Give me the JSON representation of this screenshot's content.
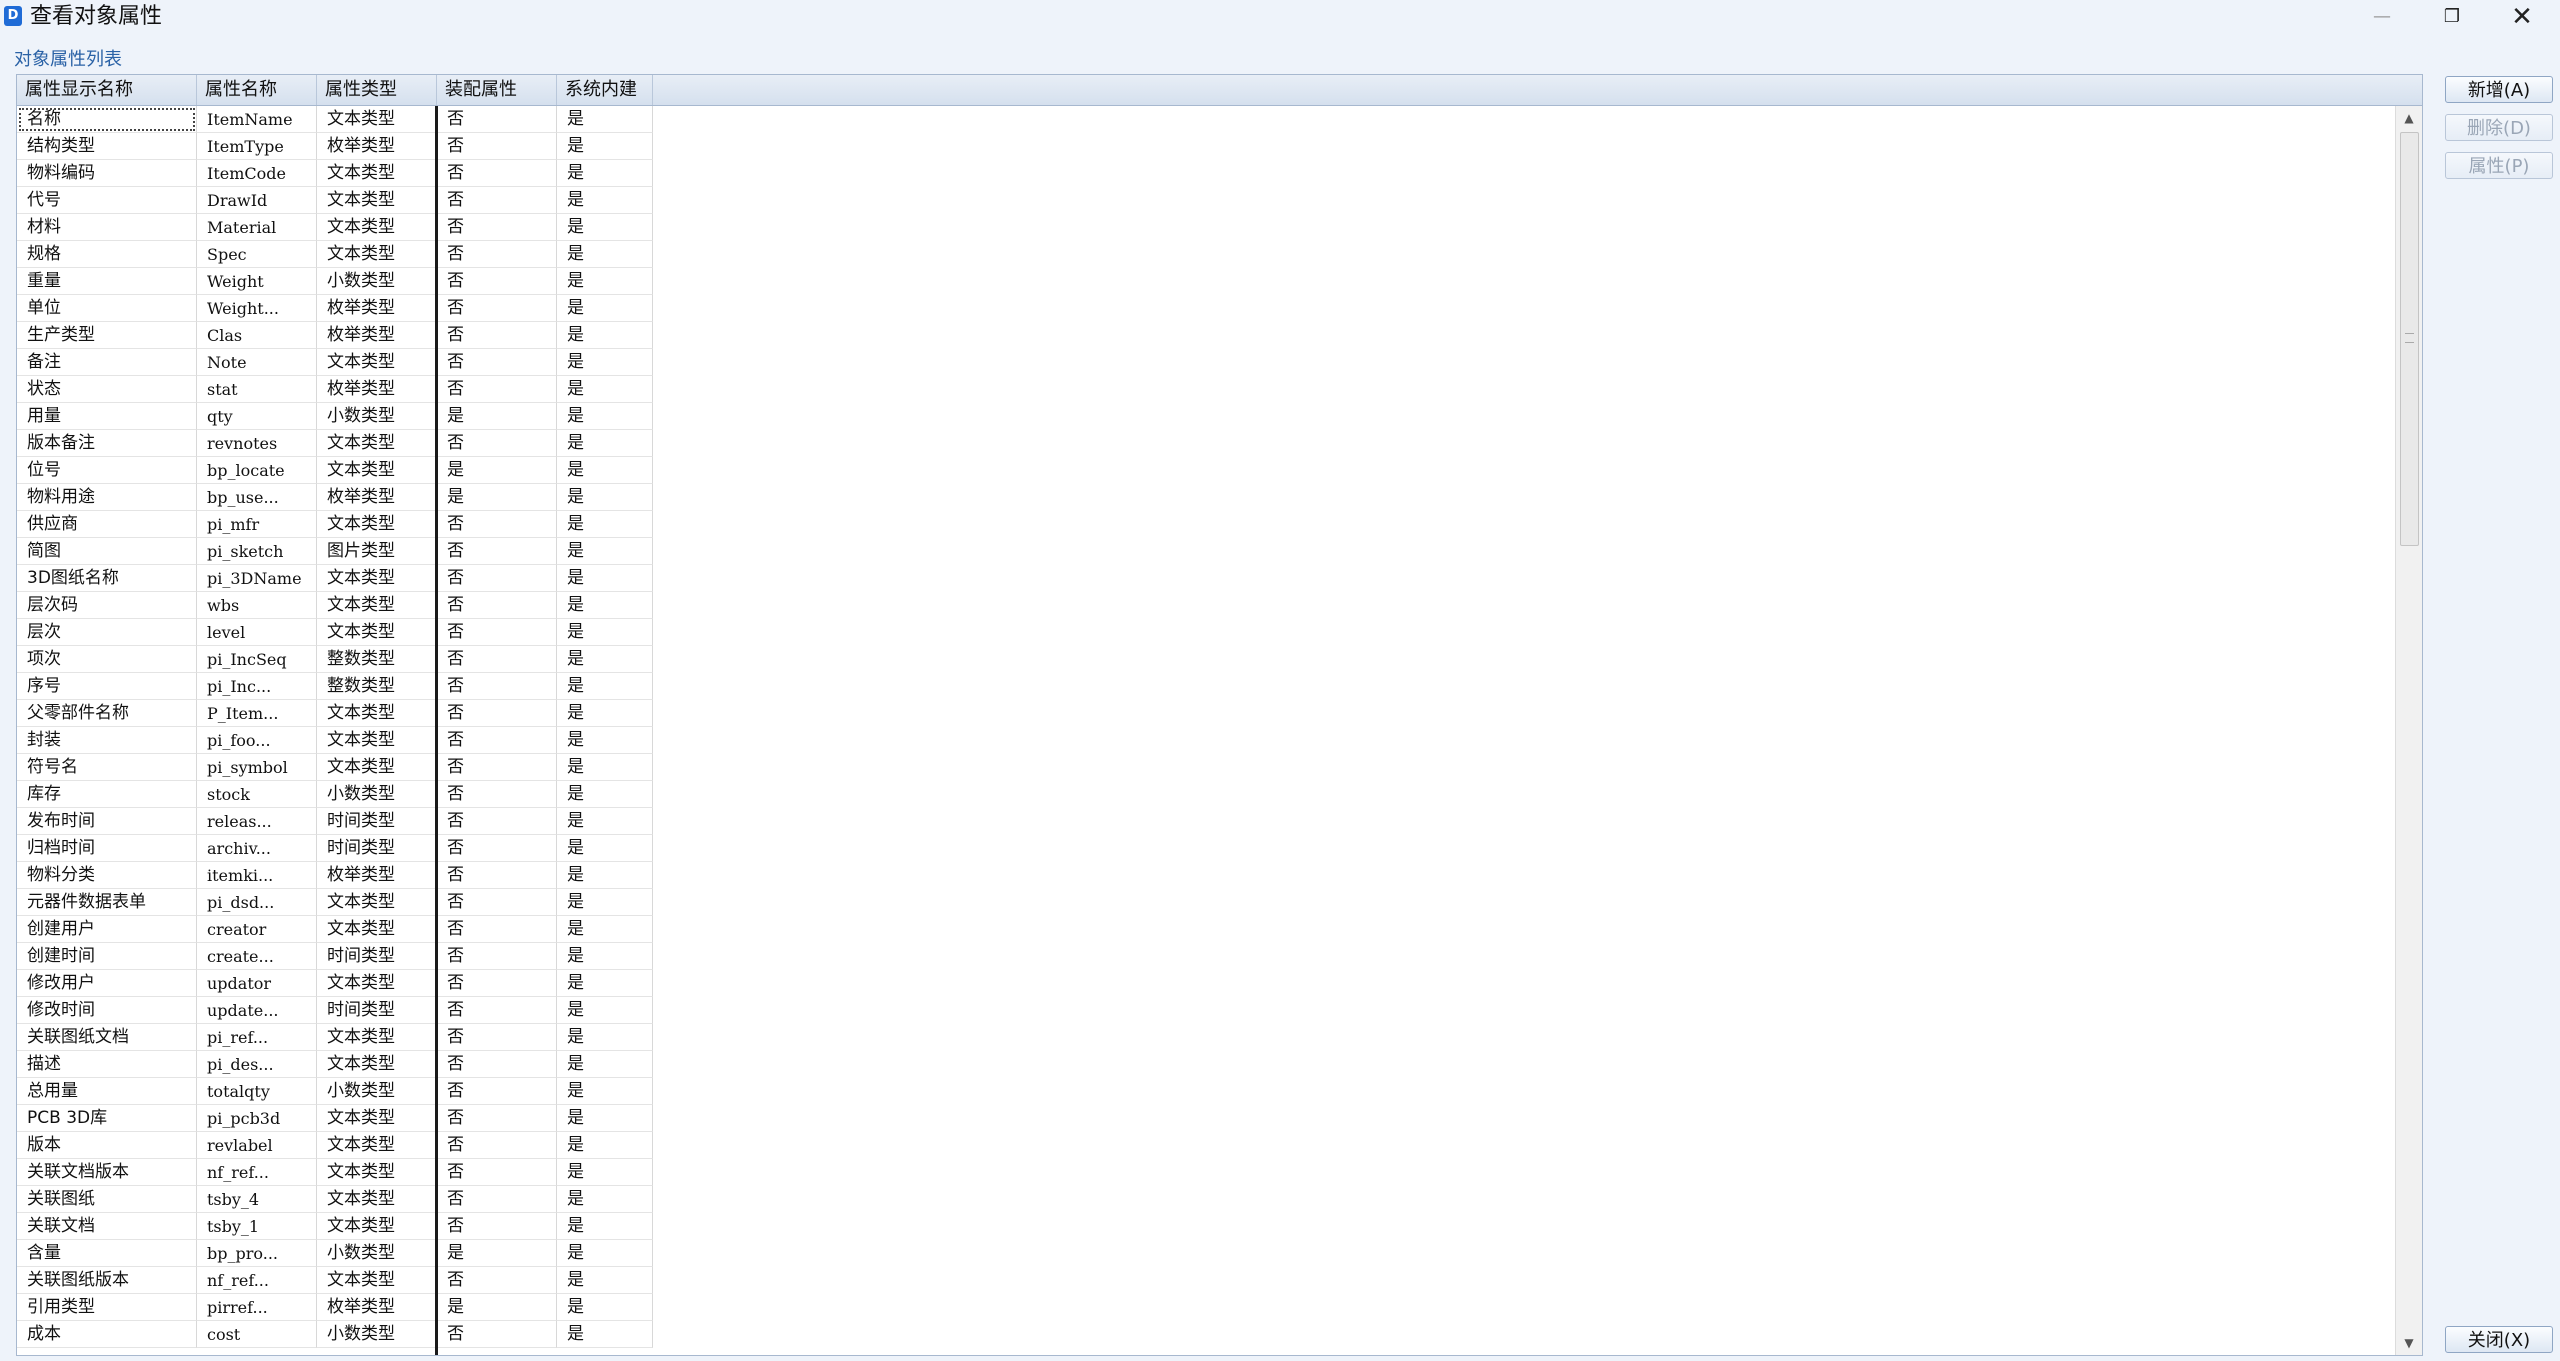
{
  "window": {
    "title": "查看对象属性",
    "app_icon_glyph": "D"
  },
  "list_caption": "对象属性列表",
  "columns": [
    "属性显示名称",
    "属性名称",
    "属性类型",
    "装配属性",
    "系统内建"
  ],
  "rows": [
    [
      "名称",
      "ItemName",
      "文本类型",
      "否",
      "是"
    ],
    [
      "结构类型",
      "ItemType",
      "枚举类型",
      "否",
      "是"
    ],
    [
      "物料编码",
      "ItemCode",
      "文本类型",
      "否",
      "是"
    ],
    [
      "代号",
      "DrawId",
      "文本类型",
      "否",
      "是"
    ],
    [
      "材料",
      "Material",
      "文本类型",
      "否",
      "是"
    ],
    [
      "规格",
      "Spec",
      "文本类型",
      "否",
      "是"
    ],
    [
      "重量",
      "Weight",
      "小数类型",
      "否",
      "是"
    ],
    [
      "单位",
      "Weight...",
      "枚举类型",
      "否",
      "是"
    ],
    [
      "生产类型",
      "Clas",
      "枚举类型",
      "否",
      "是"
    ],
    [
      "备注",
      "Note",
      "文本类型",
      "否",
      "是"
    ],
    [
      "状态",
      "stat",
      "枚举类型",
      "否",
      "是"
    ],
    [
      "用量",
      "qty",
      "小数类型",
      "是",
      "是"
    ],
    [
      "版本备注",
      "revnotes",
      "文本类型",
      "否",
      "是"
    ],
    [
      "位号",
      "bp_locate",
      "文本类型",
      "是",
      "是"
    ],
    [
      "物料用途",
      "bp_use...",
      "枚举类型",
      "是",
      "是"
    ],
    [
      "供应商",
      "pi_mfr",
      "文本类型",
      "否",
      "是"
    ],
    [
      "简图",
      "pi_sketch",
      "图片类型",
      "否",
      "是"
    ],
    [
      "3D图纸名称",
      "pi_3DName",
      "文本类型",
      "否",
      "是"
    ],
    [
      "层次码",
      "wbs",
      "文本类型",
      "否",
      "是"
    ],
    [
      "层次",
      "level",
      "文本类型",
      "否",
      "是"
    ],
    [
      "项次",
      "pi_IncSeq",
      "整数类型",
      "否",
      "是"
    ],
    [
      "序号",
      "pi_Inc...",
      "整数类型",
      "否",
      "是"
    ],
    [
      "父零部件名称",
      "P_Item...",
      "文本类型",
      "否",
      "是"
    ],
    [
      "封装",
      "pi_foo...",
      "文本类型",
      "否",
      "是"
    ],
    [
      "符号名",
      "pi_symbol",
      "文本类型",
      "否",
      "是"
    ],
    [
      "库存",
      "stock",
      "小数类型",
      "否",
      "是"
    ],
    [
      "发布时间",
      "releas...",
      "时间类型",
      "否",
      "是"
    ],
    [
      "归档时间",
      "archiv...",
      "时间类型",
      "否",
      "是"
    ],
    [
      "物料分类",
      "itemki...",
      "枚举类型",
      "否",
      "是"
    ],
    [
      "元器件数据表单",
      "pi_dsd...",
      "文本类型",
      "否",
      "是"
    ],
    [
      "创建用户",
      "creator",
      "文本类型",
      "否",
      "是"
    ],
    [
      "创建时间",
      "create...",
      "时间类型",
      "否",
      "是"
    ],
    [
      "修改用户",
      "updator",
      "文本类型",
      "否",
      "是"
    ],
    [
      "修改时间",
      "update...",
      "时间类型",
      "否",
      "是"
    ],
    [
      "关联图纸文档",
      "pi_ref...",
      "文本类型",
      "否",
      "是"
    ],
    [
      "描述",
      "pi_des...",
      "文本类型",
      "否",
      "是"
    ],
    [
      "总用量",
      "totalqty",
      "小数类型",
      "否",
      "是"
    ],
    [
      "PCB 3D库",
      "pi_pcb3d",
      "文本类型",
      "否",
      "是"
    ],
    [
      "版本",
      "revlabel",
      "文本类型",
      "否",
      "是"
    ],
    [
      "关联文档版本",
      "nf_ref...",
      "文本类型",
      "否",
      "是"
    ],
    [
      "关联图纸",
      "tsby_4",
      "文本类型",
      "否",
      "是"
    ],
    [
      "关联文档",
      "tsby_1",
      "文本类型",
      "否",
      "是"
    ],
    [
      "含量",
      "bp_pro...",
      "小数类型",
      "是",
      "是"
    ],
    [
      "关联图纸版本",
      "nf_ref...",
      "文本类型",
      "否",
      "是"
    ],
    [
      "引用类型",
      "pirref...",
      "枚举类型",
      "是",
      "是"
    ],
    [
      "成本",
      "cost",
      "小数类型",
      "否",
      "是"
    ]
  ],
  "scrollbar": {
    "up_glyph": "▲",
    "down_glyph": "▼"
  },
  "buttons": {
    "add": "新增(A)",
    "delete": "删除(D)",
    "properties": "属性(P)",
    "close": "关闭(X)"
  },
  "window_controls": {
    "minimize": "—",
    "restore": "❐",
    "close": "✕"
  }
}
